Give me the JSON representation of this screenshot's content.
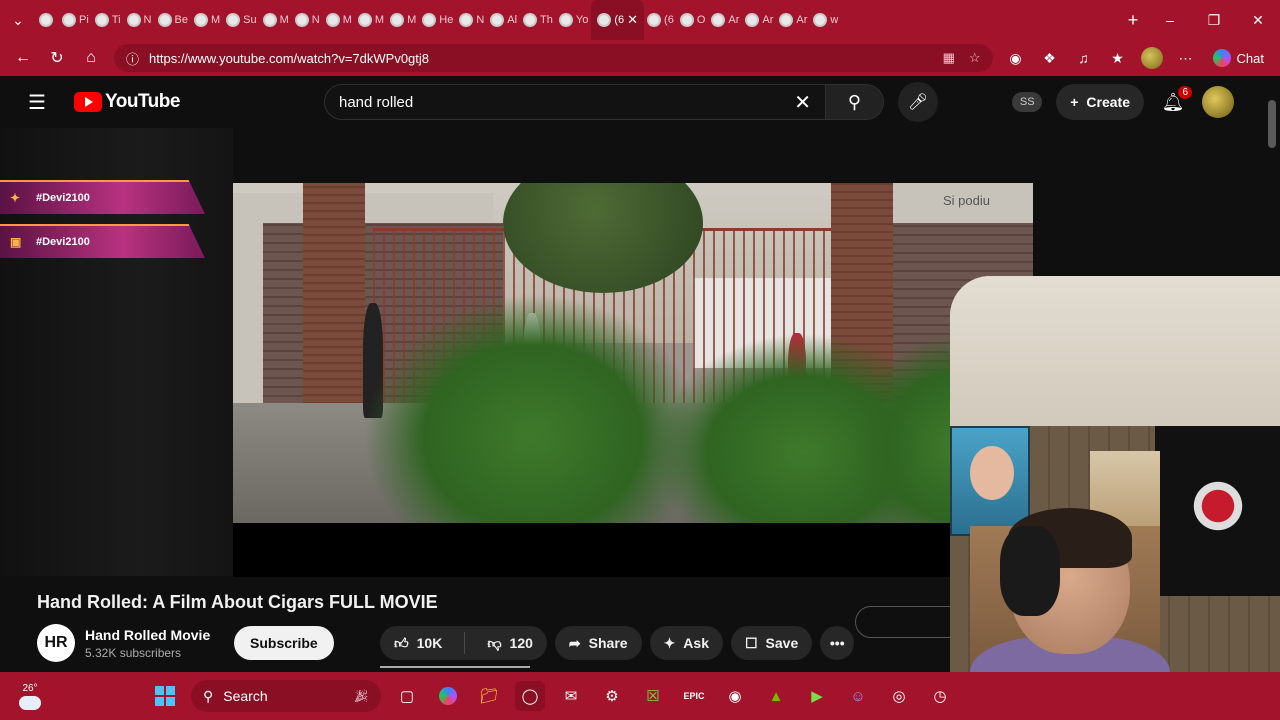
{
  "browser": {
    "tabs": [
      {
        "label": "",
        "active": false
      },
      {
        "label": "Pi",
        "active": false
      },
      {
        "label": "Ti",
        "active": false
      },
      {
        "label": "N",
        "active": false
      },
      {
        "label": "Be",
        "active": false
      },
      {
        "label": "M",
        "active": false
      },
      {
        "label": "Su",
        "active": false
      },
      {
        "label": "M",
        "active": false
      },
      {
        "label": "N",
        "active": false
      },
      {
        "label": "M",
        "active": false
      },
      {
        "label": "M",
        "active": false
      },
      {
        "label": "M",
        "active": false
      },
      {
        "label": "He",
        "active": false
      },
      {
        "label": "N",
        "active": false
      },
      {
        "label": "Al",
        "active": false
      },
      {
        "label": "Th",
        "active": false
      },
      {
        "label": "Yo",
        "active": false
      },
      {
        "label": "(6",
        "active": true
      },
      {
        "label": "(6",
        "active": false
      },
      {
        "label": "O",
        "active": false
      },
      {
        "label": "Ar",
        "active": false
      },
      {
        "label": "Ar",
        "active": false
      },
      {
        "label": "Ar",
        "active": false
      },
      {
        "label": "w",
        "active": false
      }
    ],
    "url": "https://www.youtube.com/watch?v=7dkWPv0gtj8",
    "chat_label": "Chat"
  },
  "youtube": {
    "logo_text": "YouTube",
    "search_value": "hand rolled",
    "ss_label": "SS",
    "create_label": "Create",
    "notification_count": "6"
  },
  "overlay": {
    "banners": [
      "#Devi2100",
      "#Devi2100"
    ]
  },
  "video": {
    "watermark_text": "Si podiu",
    "title": "Hand Rolled: A Film About Cigars FULL MOVIE",
    "channel_initials": "HR",
    "channel_name": "Hand Rolled Movie",
    "subscribers": "5.32K subscribers",
    "subscribe_label": "Subscribe",
    "likes": "10K",
    "dislikes": "120",
    "share_label": "Share",
    "ask_label": "Ask",
    "save_label": "Save"
  },
  "taskbar": {
    "temperature": "26°",
    "search_label": "Search"
  },
  "colors": {
    "browser_accent": "#a3132b",
    "youtube_red": "#ff0000",
    "page_bg": "#0f0f0f"
  }
}
